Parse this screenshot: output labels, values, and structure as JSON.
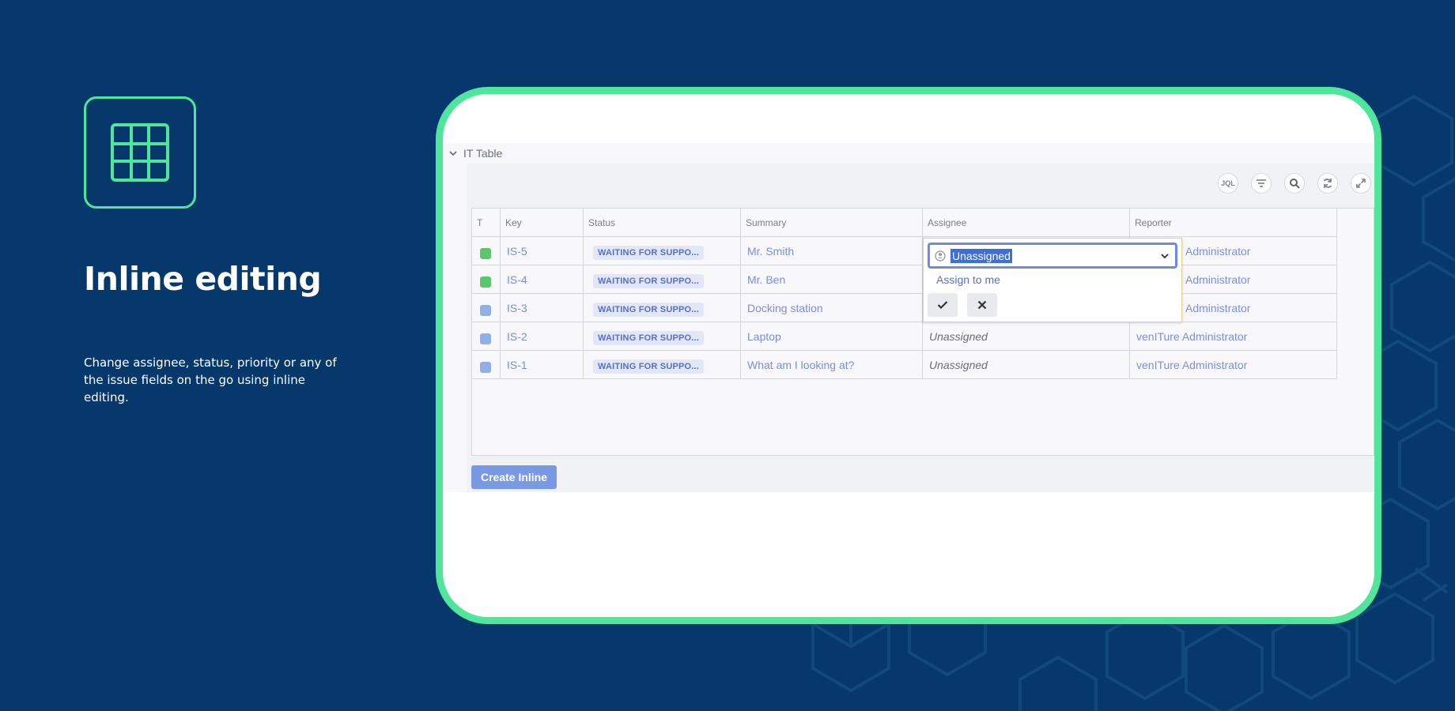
{
  "hero": {
    "title": "Inline editing",
    "description": "Change assignee, status, priority or any of the issue fields on the go using inline editing."
  },
  "panel": {
    "title": "IT Table",
    "toolbar": [
      {
        "id": "jql",
        "label": "JQL",
        "icon": "jql-icon"
      },
      {
        "id": "filter",
        "label": "",
        "icon": "filter-icon"
      },
      {
        "id": "search",
        "label": "",
        "icon": "search-icon"
      },
      {
        "id": "refresh",
        "label": "",
        "icon": "refresh-icon"
      },
      {
        "id": "expand",
        "label": "",
        "icon": "expand-icon"
      }
    ]
  },
  "table": {
    "columns": [
      "T",
      "Key",
      "Status",
      "Summary",
      "Assignee",
      "Reporter"
    ],
    "rows": [
      {
        "type": "green",
        "key": "IS-5",
        "status": "WAITING FOR SUPPO...",
        "summary": "Mr. Smith",
        "assignee": "",
        "reporter": "Administrator"
      },
      {
        "type": "green",
        "key": "IS-4",
        "status": "WAITING FOR SUPPO...",
        "summary": "Mr. Ben",
        "assignee": "",
        "reporter": "Administrator"
      },
      {
        "type": "blue",
        "key": "IS-3",
        "status": "WAITING FOR SUPPO...",
        "summary": "Docking station",
        "assignee": "",
        "reporter": "Administrator"
      },
      {
        "type": "blue",
        "key": "IS-2",
        "status": "WAITING FOR SUPPO...",
        "summary": "Laptop",
        "assignee": "Unassigned",
        "reporter": "venITure Administrator"
      },
      {
        "type": "blue",
        "key": "IS-1",
        "status": "WAITING FOR SUPPO...",
        "summary": "What am I looking at?",
        "assignee": "Unassigned",
        "reporter": "venITure Administrator"
      }
    ]
  },
  "editor": {
    "selected_value": "Unassigned",
    "assign_me_label": "Assign to me"
  },
  "create_button_label": "Create Inline",
  "colors": {
    "background": "#06386c",
    "accent": "#4fe59a",
    "link": "#7b8fd6",
    "button": "#7a99e4"
  }
}
